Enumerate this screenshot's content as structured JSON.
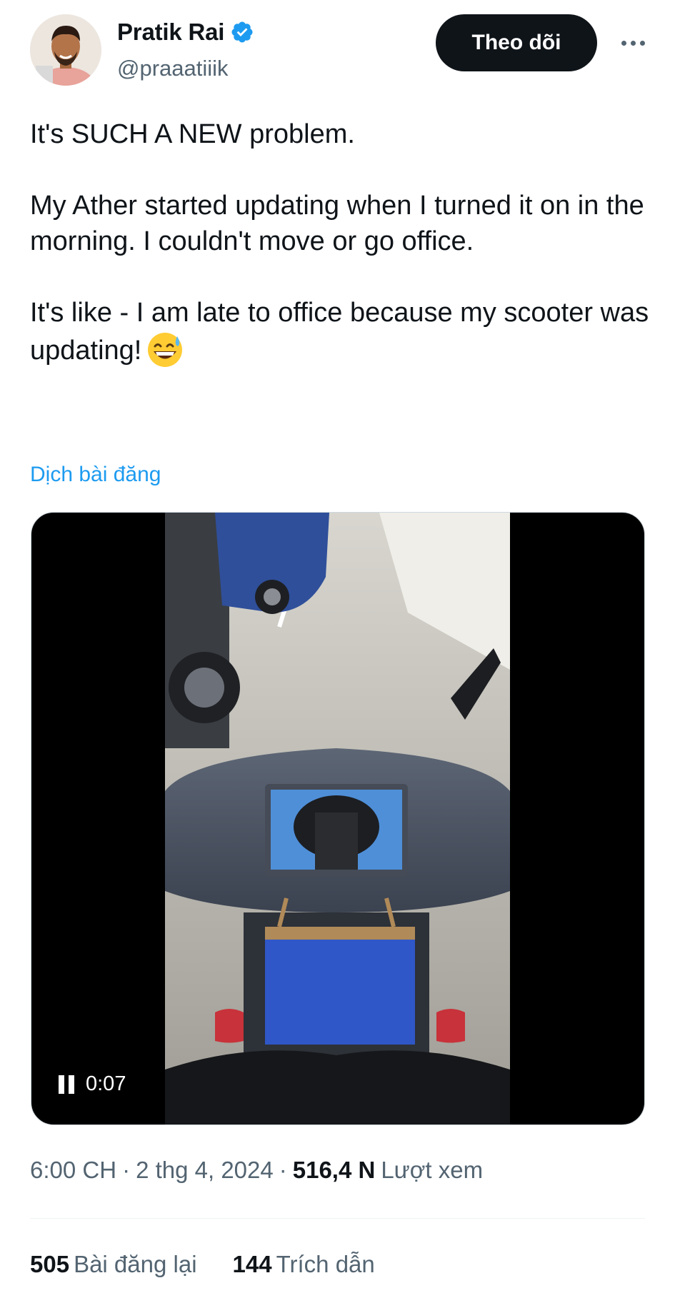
{
  "author": {
    "display_name": "Pratik Rai",
    "handle": "@praaatiiik",
    "verified": true,
    "verified_color": "#1d9bf0"
  },
  "actions": {
    "follow_label": "Theo dõi",
    "more_icon": "more-horizontal-icon"
  },
  "tweet": {
    "paragraphs": [
      "It's SUCH A NEW problem.",
      "My Ather started updating when I turned it on in the morning. I couldn't move or go office.",
      "It's like - I am late to office because my scooter was updating!"
    ],
    "emoji": "grinning-face-with-sweat-icon",
    "translate_label": "Dịch bài đăng"
  },
  "media": {
    "type": "video",
    "timecode": "0:07",
    "state": "playing"
  },
  "meta": {
    "time": "6:00 CH",
    "date": "2 thg 4, 2024",
    "views_count": "516,4 N",
    "views_label": "Lượt xem"
  },
  "stats": {
    "reposts_count": "505",
    "reposts_label": "Bài đăng lại",
    "quotes_count": "144",
    "quotes_label": "Trích dẫn"
  },
  "colors": {
    "text_primary": "#0f1419",
    "text_secondary": "#536471",
    "link": "#1d9bf0",
    "button_bg": "#0f1419"
  }
}
